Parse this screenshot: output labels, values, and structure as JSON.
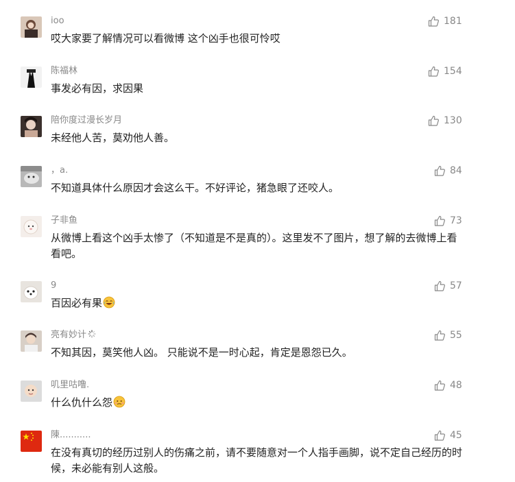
{
  "comments": [
    {
      "user": "ioo",
      "text": "哎大家要了解情况可以看微博 这个凶手也很可怜哎",
      "likes": "181",
      "avatar": "avatar-photo-icon"
    },
    {
      "user": "陈福林",
      "text": "事发必有因，求因果",
      "likes": "154",
      "avatar": "avatar-suit-icon"
    },
    {
      "user": "陪你度过漫长岁月",
      "text": "未经他人苦，莫劝他人善。",
      "likes": "130",
      "avatar": "avatar-photo-icon"
    },
    {
      "user": "，a.",
      "text": "不知道具体什么原因才会这么干。不好评论，猪急眼了还咬人。",
      "likes": "84",
      "avatar": "avatar-photo-icon"
    },
    {
      "user": "子非鱼",
      "text": "从微博上看这个凶手太惨了（不知道是不是真的）。这里发不了图片，想了解的去微博上看看吧。",
      "likes": "73",
      "avatar": "avatar-photo-icon"
    },
    {
      "user": "9",
      "text": "百因必有果",
      "emoji": "laughing-tears-emoji",
      "likes": "57",
      "avatar": "avatar-dog-icon"
    },
    {
      "user": "亮有妙计",
      "badge": "loading-badge-icon",
      "text": "不知其因，莫笑他人凶。 只能说不是一时心起，肯定是恩怨已久。",
      "likes": "55",
      "avatar": "avatar-photo-icon"
    },
    {
      "user": "叽里咕噜.",
      "text": "什么仇什么怨",
      "emoji": "sweat-face-emoji",
      "likes": "48",
      "avatar": "avatar-baby-icon"
    },
    {
      "user": "陳...........",
      "text": "在没有真切的经历过别人的伤痛之前，请不要随意对一个人指手画脚，说不定自己经历的时候，未必能有别人这般。",
      "likes": "45",
      "avatar": "avatar-flag-icon"
    }
  ],
  "colors": {
    "username": "#888888",
    "text": "#222222",
    "likes": "#888888",
    "background": "#ffffff"
  }
}
